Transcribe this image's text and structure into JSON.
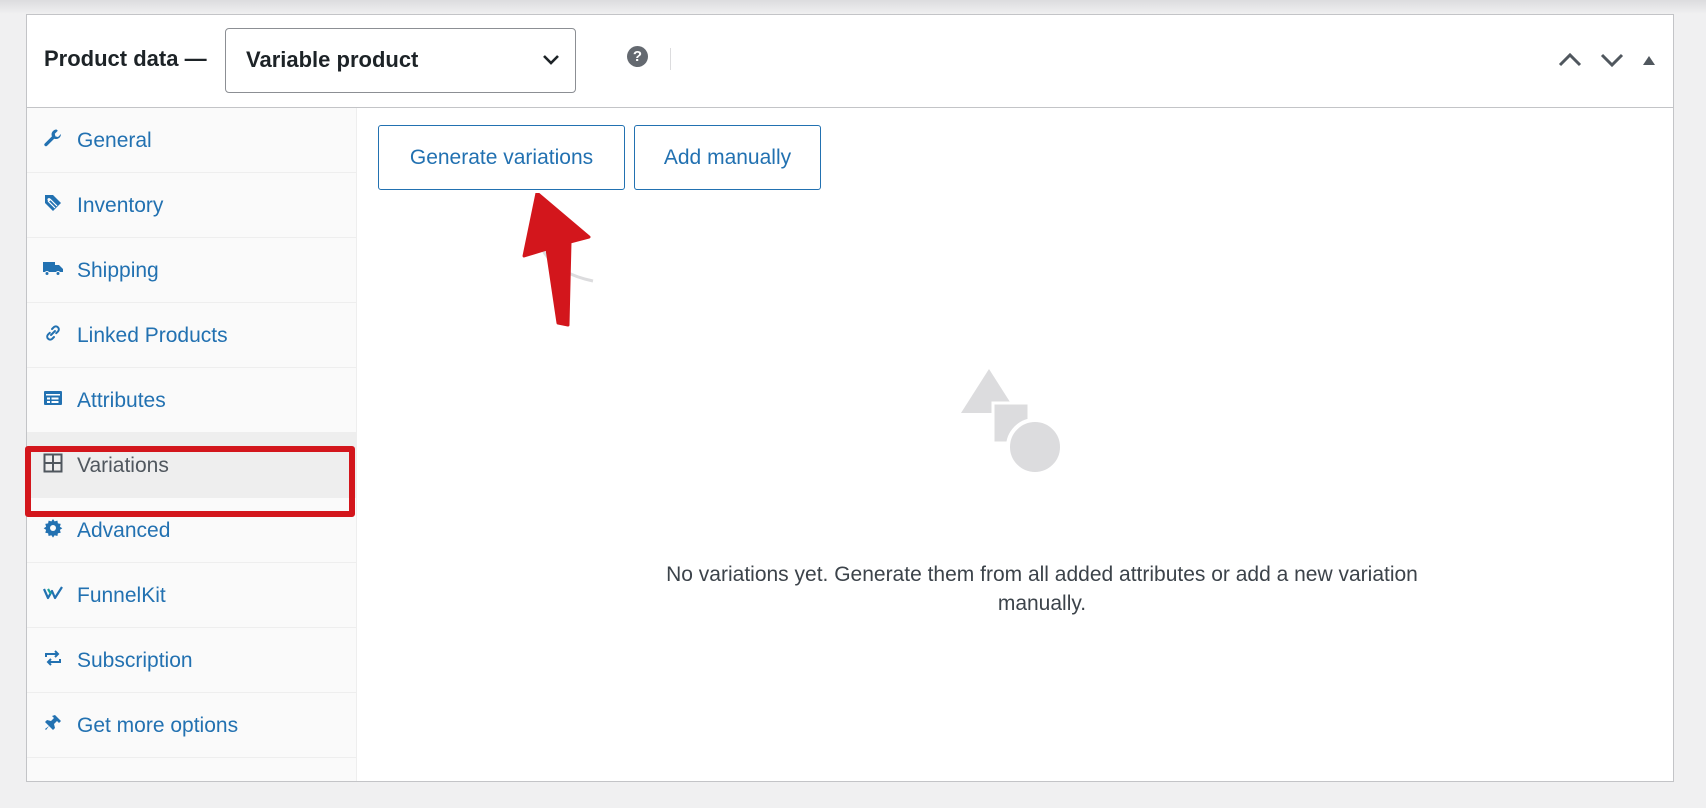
{
  "header": {
    "title": "Product data —",
    "product_type": "Variable product",
    "help": "?"
  },
  "sidebar": {
    "items": [
      {
        "label": "General",
        "icon": "wrench-icon"
      },
      {
        "label": "Inventory",
        "icon": "tag-icon"
      },
      {
        "label": "Shipping",
        "icon": "truck-icon"
      },
      {
        "label": "Linked Products",
        "icon": "link-icon"
      },
      {
        "label": "Attributes",
        "icon": "list-card-icon"
      },
      {
        "label": "Variations",
        "icon": "grid-icon",
        "active": true
      },
      {
        "label": "Advanced",
        "icon": "gear-icon"
      },
      {
        "label": "FunnelKit",
        "icon": "funnelkit-icon"
      },
      {
        "label": "Subscription",
        "icon": "repeat-icon"
      },
      {
        "label": "Get more options",
        "icon": "plugin-icon"
      }
    ]
  },
  "actions": {
    "generate": "Generate variations",
    "add_manually": "Add manually"
  },
  "empty_state": {
    "message": "No variations yet. Generate them from all added attributes or add a new variation manually."
  },
  "colors": {
    "link": "#2271b1",
    "highlight": "#d3161c",
    "border": "#c3c4c7"
  }
}
